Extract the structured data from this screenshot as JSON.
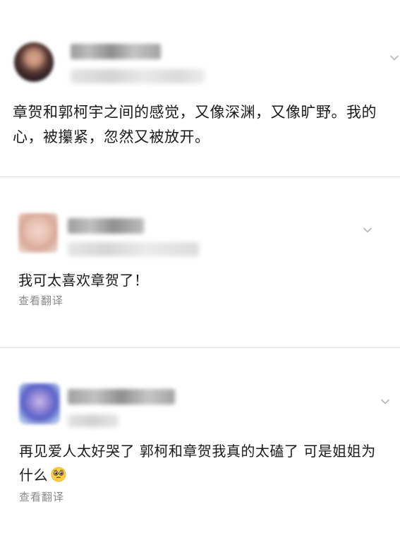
{
  "posts": [
    {
      "text": "章贺和郭柯宇之间的感觉，又像深渊，又像旷野。我的心，被攥紧，忽然又被放开。",
      "avatar_icon": "user-avatar-blurred",
      "menu_icon": "chevron-down-icon"
    },
    {
      "text": "我可太喜欢章贺了！",
      "translate_label": "查看翻译",
      "avatar_icon": "user-avatar-blurred",
      "menu_icon": "chevron-down-icon"
    },
    {
      "text": "再见爱人太好哭了 郭柯和章贺我真的太磕了 可是姐姐为什么",
      "emoji": "pleading-face",
      "translate_label": "查看翻译",
      "avatar_icon": "user-avatar-blurred",
      "menu_icon": "chevron-down-icon"
    }
  ],
  "colors": {
    "text": "#1a1a1a",
    "muted": "#8a8a8a",
    "divider": "#dedede"
  }
}
